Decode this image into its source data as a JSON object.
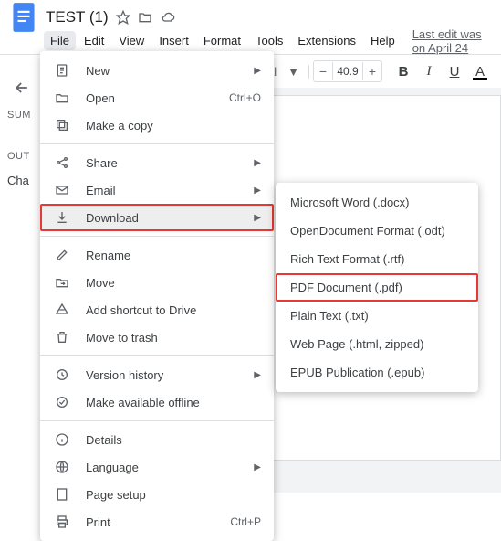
{
  "document": {
    "title": "TEST (1)"
  },
  "menubar": {
    "items": [
      "File",
      "Edit",
      "View",
      "Insert",
      "Format",
      "Tools",
      "Extensions",
      "Help"
    ],
    "last_edit": "Last edit was on April 24"
  },
  "toolbar": {
    "font_label": "ial",
    "zoom_value": "40.9",
    "bold": "B",
    "italic": "I",
    "underline": "U",
    "color": "A"
  },
  "outline": {
    "summary": "SUM",
    "outline": "OUT",
    "chapter": "Cha"
  },
  "file_menu": {
    "new": "New",
    "open": "Open",
    "open_shortcut": "Ctrl+O",
    "make_copy": "Make a copy",
    "share": "Share",
    "email": "Email",
    "download": "Download",
    "rename": "Rename",
    "move": "Move",
    "add_shortcut": "Add shortcut to Drive",
    "trash": "Move to trash",
    "version": "Version history",
    "offline": "Make available offline",
    "details": "Details",
    "language": "Language",
    "page_setup": "Page setup",
    "print": "Print",
    "print_shortcut": "Ctrl+P"
  },
  "download_menu": {
    "docx": "Microsoft Word (.docx)",
    "odt": "OpenDocument Format (.odt)",
    "rtf": "Rich Text Format (.rtf)",
    "pdf": "PDF Document (.pdf)",
    "txt": "Plain Text (.txt)",
    "html": "Web Page (.html, zipped)",
    "epub": "EPUB Publication (.epub)"
  }
}
